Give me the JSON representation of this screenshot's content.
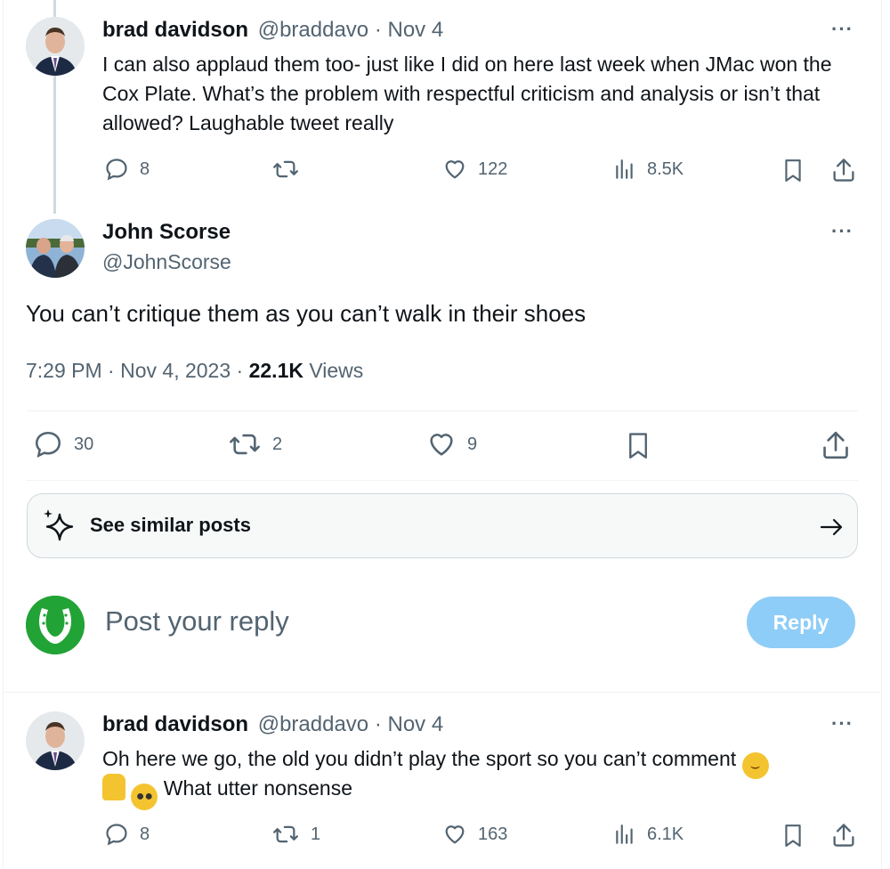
{
  "parent_post": {
    "display_name": "brad davidson",
    "handle": "@braddavo",
    "date": "Nov 4",
    "text": "I can also applaud them too- just like I did on here last week when JMac won the Cox Plate. What’s the problem with respectful criticism and analysis or isn’t that allowed? Laughable tweet really",
    "replies": "8",
    "reposts": "",
    "likes": "122",
    "views": "8.5K"
  },
  "main_post": {
    "display_name": "John Scorse",
    "handle": "@JohnScorse",
    "text": "You can’t critique them as you can’t walk in their shoes",
    "time": "7:29 PM",
    "date": "Nov 4, 2023",
    "views_count": "22.1K",
    "views_label": "Views",
    "replies": "30",
    "reposts": "2",
    "likes": "9"
  },
  "similar": {
    "label": "See similar posts"
  },
  "composer": {
    "placeholder": "Post your reply",
    "reply_button": "Reply",
    "avatar_color": "#1f9a31"
  },
  "reply_post": {
    "display_name": "brad davidson",
    "handle": "@braddavo",
    "date": "Nov 4",
    "text_line1": "Oh here we go, the old you didn’t play the sport so you can’t comment",
    "text_line2": "What utter nonsense",
    "emojis": [
      "rolling-on-floor-laughing",
      "man-facepalming",
      "flushed-face"
    ],
    "replies": "8",
    "reposts": "1",
    "likes": "163",
    "views": "6.1K"
  },
  "colors": {
    "text": "#0f1419",
    "muted": "#536471",
    "accent_disabled": "#8ecdf7",
    "border": "#eff3f4"
  }
}
